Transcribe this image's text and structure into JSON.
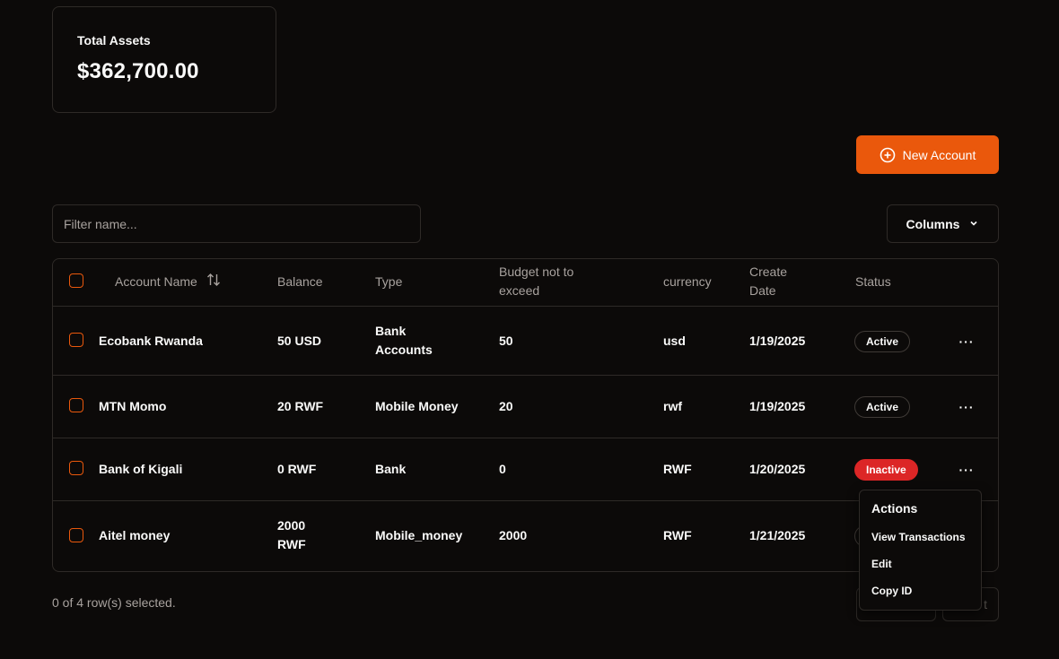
{
  "summary": {
    "title": "Total Assets",
    "value": "$362,700.00"
  },
  "toolbar": {
    "new_account_label": "New Account",
    "filter_placeholder": "Filter name...",
    "columns_label": "Columns"
  },
  "table": {
    "headers": {
      "account_name": "Account Name",
      "balance": "Balance",
      "type": "Type",
      "budget_line1": "Budget not to",
      "budget_line2": "exceed",
      "currency": "currency",
      "create_line1": "Create",
      "create_line2": "Date",
      "status": "Status"
    },
    "rows": [
      {
        "name": "Ecobank Rwanda",
        "balance": "50 USD",
        "balance_line2": "",
        "type": "Bank",
        "type_line2": "Accounts",
        "budget": "50",
        "currency": "usd",
        "date": "1/19/2025",
        "status": "Active"
      },
      {
        "name": "MTN Momo",
        "balance": "20 RWF",
        "balance_line2": "",
        "type": "Mobile Money",
        "type_line2": "",
        "budget": "20",
        "currency": "rwf",
        "date": "1/19/2025",
        "status": "Active"
      },
      {
        "name": "Bank of Kigali",
        "balance": "0 RWF",
        "balance_line2": "",
        "type": "Bank",
        "type_line2": "",
        "budget": "0",
        "currency": "RWF",
        "date": "1/20/2025",
        "status": "Inactive"
      },
      {
        "name": "Aitel money",
        "balance": "2000",
        "balance_line2": "RWF",
        "type": "Mobile_money",
        "type_line2": "",
        "budget": "2000",
        "currency": "RWF",
        "date": "1/21/2025",
        "status": ""
      }
    ]
  },
  "footer": {
    "selection_text": "0 of 4 row(s) selected.",
    "next_label_partial": "t"
  },
  "actions_menu": {
    "title": "Actions",
    "items": [
      "View Transactions",
      "Edit",
      "Copy ID"
    ]
  },
  "colors": {
    "accent": "#ea580c",
    "inactive": "#dc2626",
    "background": "#0c0a09"
  }
}
